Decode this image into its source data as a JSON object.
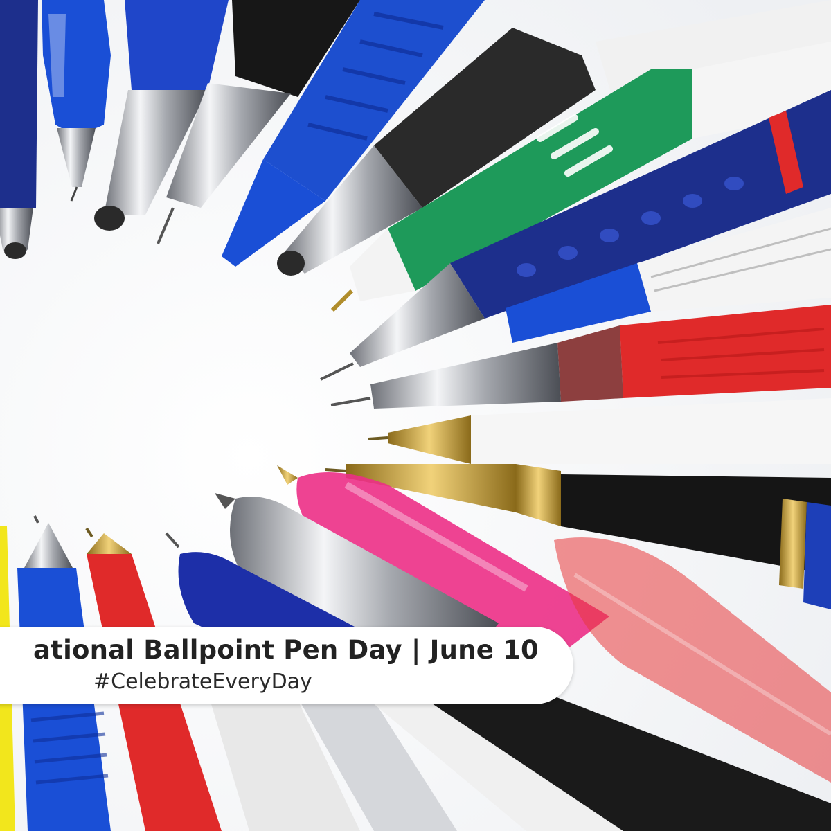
{
  "banner": {
    "title": "ational Ballpoint Pen Day | June 10",
    "hashtag": "#CelebrateEveryDay"
  },
  "photo": {
    "subject": "ballpoint-pens-arranged-in-circle",
    "colors": {
      "background": "#ffffff",
      "navy": "#1d2f8c",
      "royal_blue": "#1a4fd6",
      "green": "#1e9a5a",
      "red": "#e02a2a",
      "pink": "#ec2f86",
      "black": "#151515",
      "silver": "#c7cacf",
      "gold": "#c9a238",
      "white_barrel": "#f3f3f3",
      "yellow": "#f2e61c"
    }
  }
}
